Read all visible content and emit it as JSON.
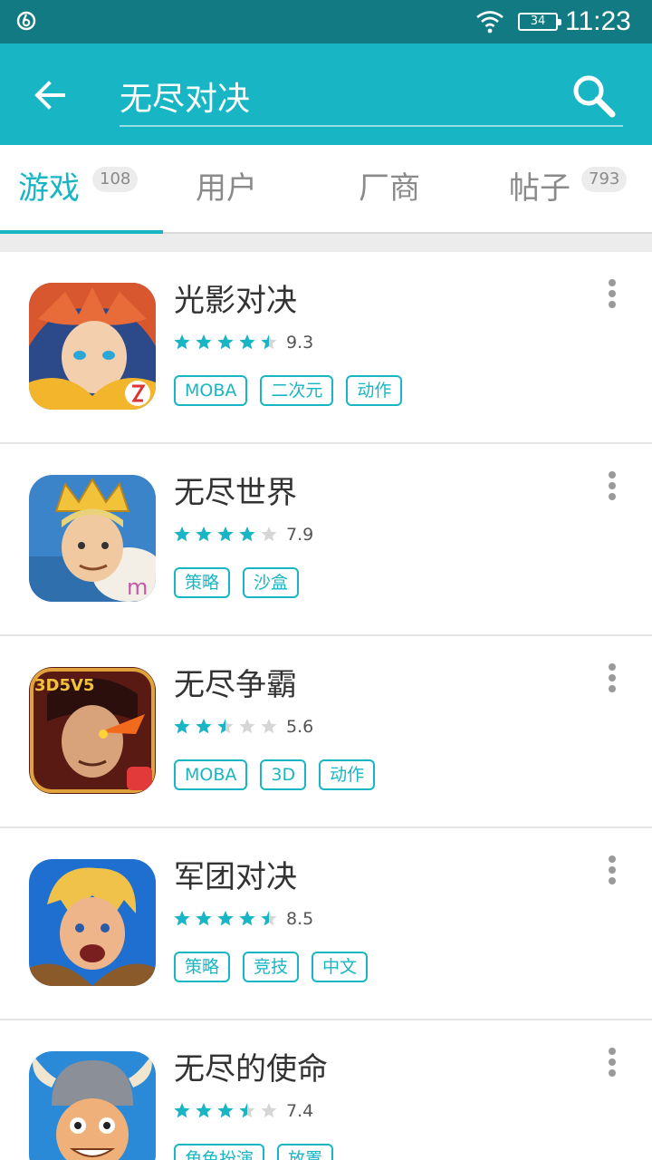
{
  "status_bar": {
    "time": "11:23",
    "battery": "34",
    "icons": [
      "app-icon",
      "wifi-icon",
      "battery-icon"
    ]
  },
  "search": {
    "query": "无尽对决",
    "back_icon": "back-arrow-icon",
    "search_icon": "search-icon"
  },
  "tabs": [
    {
      "label": "游戏",
      "count": "108",
      "active": true
    },
    {
      "label": "用户",
      "count": ""
    },
    {
      "label": "厂商",
      "count": ""
    },
    {
      "label": "帖子",
      "count": "793"
    }
  ],
  "colors": {
    "accent": "#18b6c4",
    "status_bar": "#127a82",
    "star_empty": "#d6d6d6"
  },
  "games": [
    {
      "name": "光影对决",
      "rating": "9.3",
      "stars": 4.5,
      "tags": [
        "MOBA",
        "二次元",
        "动作"
      ]
    },
    {
      "name": "无尽世界",
      "rating": "7.9",
      "stars": 4,
      "tags": [
        "策略",
        "沙盒"
      ]
    },
    {
      "name": "无尽争霸",
      "rating": "5.6",
      "stars": 2.5,
      "tags": [
        "MOBA",
        "3D",
        "动作"
      ]
    },
    {
      "name": "军团对决",
      "rating": "8.5",
      "stars": 4.5,
      "tags": [
        "策略",
        "竞技",
        "中文"
      ]
    },
    {
      "name": "无尽的使命",
      "rating": "7.4",
      "stars": 3.5,
      "tags": [
        "角色扮演",
        "放置"
      ]
    }
  ]
}
